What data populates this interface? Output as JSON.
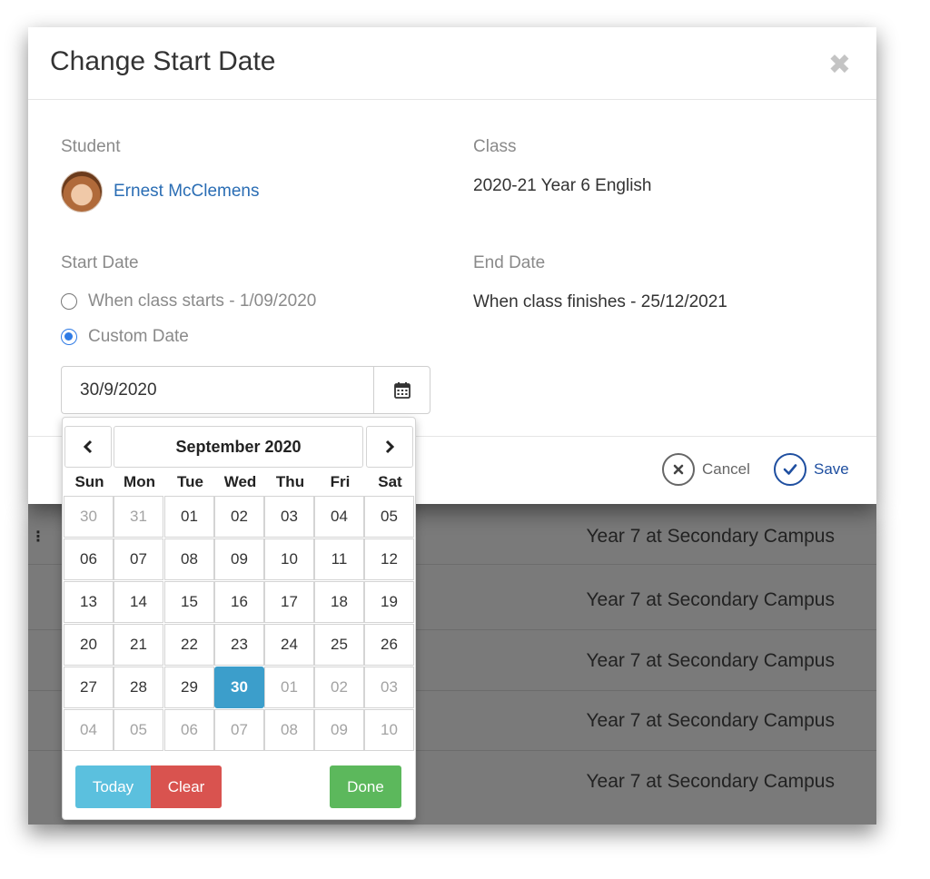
{
  "modal": {
    "title": "Change Start Date",
    "student_label": "Student",
    "student_name": "Ernest McClemens",
    "class_label": "Class",
    "class_value": "2020-21 Year 6 English",
    "start_date_label": "Start Date",
    "option_class_starts": "When class starts - 1/09/2020",
    "option_custom": "Custom Date",
    "date_value": "30/9/2020",
    "end_date_label": "End Date",
    "end_date_value": "When class finishes - 25/12/2021",
    "cancel_label": "Cancel",
    "save_label": "Save"
  },
  "datepicker": {
    "month_label": "September 2020",
    "prev": "‹",
    "next": "›",
    "days_of_week": [
      "Sun",
      "Mon",
      "Tue",
      "Wed",
      "Thu",
      "Fri",
      "Sat"
    ],
    "weeks": [
      [
        "30",
        "31",
        "01",
        "02",
        "03",
        "04",
        "05"
      ],
      [
        "06",
        "07",
        "08",
        "09",
        "10",
        "11",
        "12"
      ],
      [
        "13",
        "14",
        "15",
        "16",
        "17",
        "18",
        "19"
      ],
      [
        "20",
        "21",
        "22",
        "23",
        "24",
        "25",
        "26"
      ],
      [
        "27",
        "28",
        "29",
        "30",
        "01",
        "02",
        "03"
      ],
      [
        "04",
        "05",
        "06",
        "07",
        "08",
        "09",
        "10"
      ]
    ],
    "today_label": "Today",
    "clear_label": "Clear",
    "done_label": "Done",
    "colors": {
      "today": "#5bc0de",
      "clear": "#d9534f",
      "done": "#5cb85c",
      "active": "#3c9ecb"
    }
  },
  "background": {
    "rows": [
      "Year 7 at Secondary Campus",
      "Year 7 at Secondary Campus",
      "Year 7 at Secondary Campus",
      "Year 7 at Secondary Campus",
      "Year 7 at Secondary Campus"
    ]
  },
  "colors": {
    "link": "#2a6db4",
    "save": "#1f4fa0",
    "radio_checked": "#2f7be5"
  }
}
